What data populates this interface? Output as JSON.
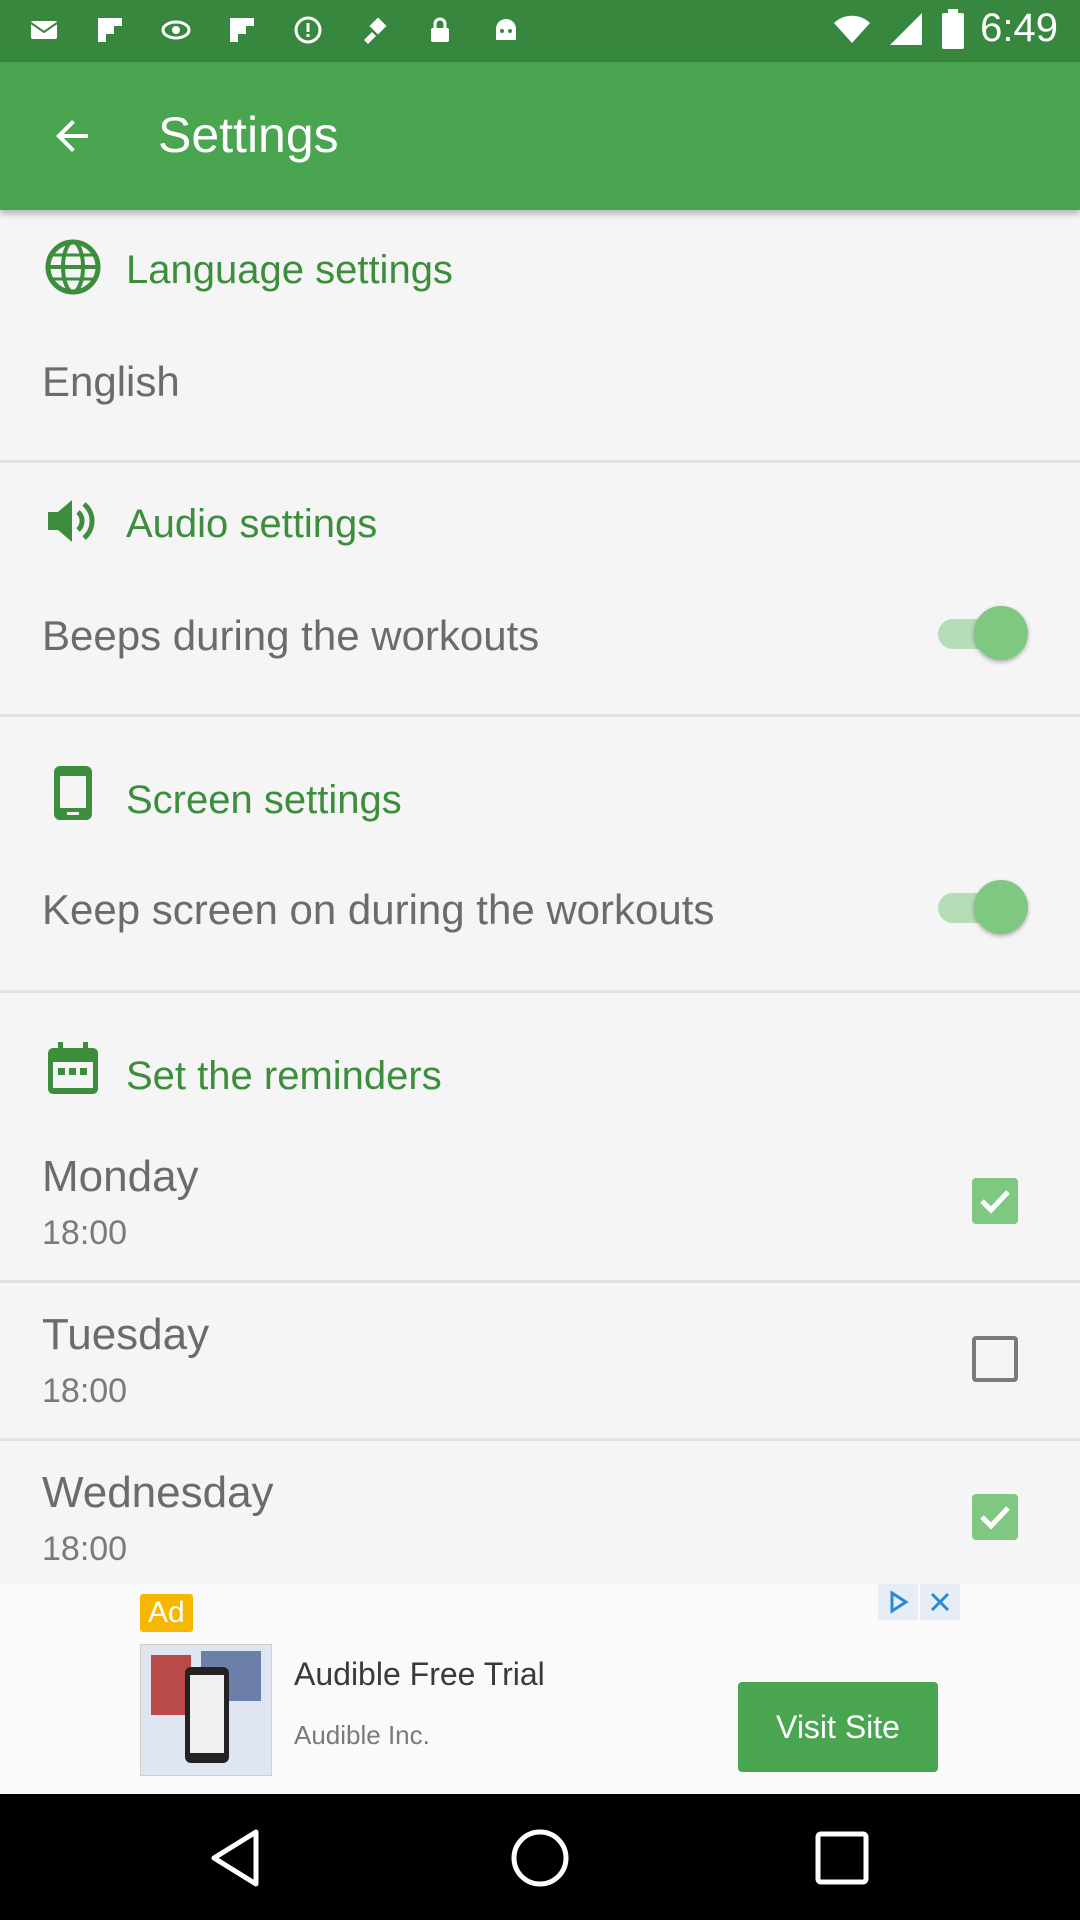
{
  "status_bar": {
    "time": "6:49",
    "left_icons": [
      "message-icon",
      "flipboard-icon",
      "eye-icon",
      "flipboard-icon",
      "alert-icon",
      "fake-gps-icon",
      "lock-icon",
      "android-icon"
    ],
    "right_icons": [
      "wifi-icon",
      "signal-icon",
      "battery-icon"
    ]
  },
  "toolbar": {
    "title": "Settings",
    "back_icon": "arrow-back-icon"
  },
  "sections": {
    "language": {
      "icon": "globe-icon",
      "title": "Language settings",
      "value": "English"
    },
    "audio": {
      "icon": "speaker-icon",
      "title": "Audio settings",
      "option_label": "Beeps during the workouts",
      "option_enabled": true
    },
    "screen": {
      "icon": "phone-icon",
      "title": "Screen settings",
      "option_label": "Keep screen on during the workouts",
      "option_enabled": true
    },
    "reminders": {
      "icon": "calendar-icon",
      "title": "Set the reminders",
      "days": [
        {
          "name": "Monday",
          "time": "18:00",
          "checked": true
        },
        {
          "name": "Tuesday",
          "time": "18:00",
          "checked": false
        },
        {
          "name": "Wednesday",
          "time": "18:00",
          "checked": true
        }
      ]
    }
  },
  "ad": {
    "badge": "Ad",
    "title": "Audible Free Trial",
    "advertiser": "Audible Inc.",
    "cta": "Visit Site"
  },
  "colors": {
    "status_bar": "#38873f",
    "toolbar": "#4aa551",
    "accent_text": "#3c8d3c",
    "toggle_on": "#7fc882"
  }
}
